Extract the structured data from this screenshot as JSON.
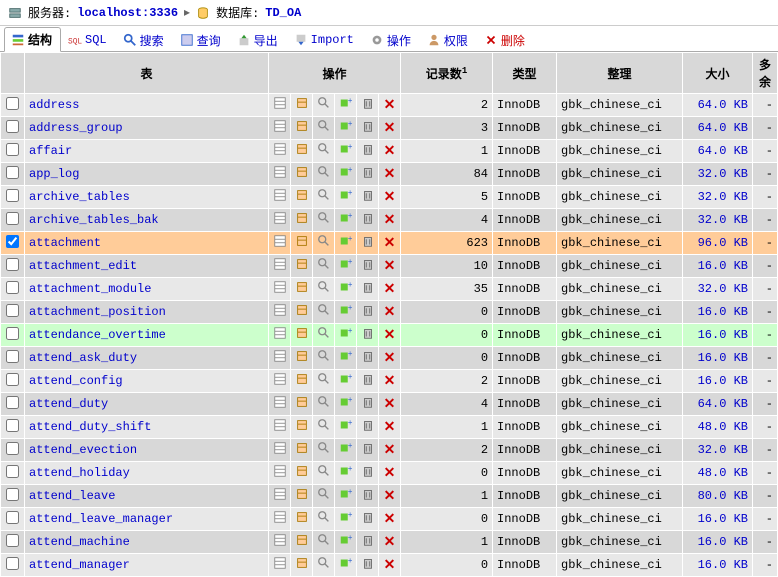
{
  "breadcrumb": {
    "server_label": "服务器: ",
    "server_value": "localhost:3336",
    "db_label": "数据库: ",
    "db_value": "TD_OA"
  },
  "tabs": [
    {
      "label": "结构",
      "icon": "structure-icon"
    },
    {
      "label": "SQL",
      "icon": "sql-icon"
    },
    {
      "label": "搜索",
      "icon": "search-icon"
    },
    {
      "label": "查询",
      "icon": "query-icon"
    },
    {
      "label": "导出",
      "icon": "export-icon"
    },
    {
      "label": "Import",
      "icon": "import-icon"
    },
    {
      "label": "操作",
      "icon": "operations-icon"
    },
    {
      "label": "权限",
      "icon": "privileges-icon"
    },
    {
      "label": "删除",
      "icon": "drop-icon"
    }
  ],
  "headers": {
    "table": "表",
    "action": "操作",
    "records": "记录数",
    "records_sup": "1",
    "type": "类型",
    "collation": "整理",
    "size": "大小",
    "overhead": "多余"
  },
  "rows": [
    {
      "name": "address",
      "rows": 2,
      "type": "InnoDB",
      "coll": "gbk_chinese_ci",
      "size": "64.0 KB",
      "ov": "-",
      "cls": "odd"
    },
    {
      "name": "address_group",
      "rows": 3,
      "type": "InnoDB",
      "coll": "gbk_chinese_ci",
      "size": "64.0 KB",
      "ov": "-",
      "cls": "even"
    },
    {
      "name": "affair",
      "rows": 1,
      "type": "InnoDB",
      "coll": "gbk_chinese_ci",
      "size": "64.0 KB",
      "ov": "-",
      "cls": "odd"
    },
    {
      "name": "app_log",
      "rows": 84,
      "type": "InnoDB",
      "coll": "gbk_chinese_ci",
      "size": "32.0 KB",
      "ov": "-",
      "cls": "even"
    },
    {
      "name": "archive_tables",
      "rows": 5,
      "type": "InnoDB",
      "coll": "gbk_chinese_ci",
      "size": "32.0 KB",
      "ov": "-",
      "cls": "odd"
    },
    {
      "name": "archive_tables_bak",
      "rows": 4,
      "type": "InnoDB",
      "coll": "gbk_chinese_ci",
      "size": "32.0 KB",
      "ov": "-",
      "cls": "even"
    },
    {
      "name": "attachment",
      "rows": 623,
      "type": "InnoDB",
      "coll": "gbk_chinese_ci",
      "size": "96.0 KB",
      "ov": "-",
      "cls": "marked",
      "checked": true
    },
    {
      "name": "attachment_edit",
      "rows": 10,
      "type": "InnoDB",
      "coll": "gbk_chinese_ci",
      "size": "16.0 KB",
      "ov": "-",
      "cls": "even"
    },
    {
      "name": "attachment_module",
      "rows": 35,
      "type": "InnoDB",
      "coll": "gbk_chinese_ci",
      "size": "32.0 KB",
      "ov": "-",
      "cls": "odd"
    },
    {
      "name": "attachment_position",
      "rows": 0,
      "type": "InnoDB",
      "coll": "gbk_chinese_ci",
      "size": "16.0 KB",
      "ov": "-",
      "cls": "even"
    },
    {
      "name": "attendance_overtime",
      "rows": 0,
      "type": "InnoDB",
      "coll": "gbk_chinese_ci",
      "size": "16.0 KB",
      "ov": "-",
      "cls": "marked-green"
    },
    {
      "name": "attend_ask_duty",
      "rows": 0,
      "type": "InnoDB",
      "coll": "gbk_chinese_ci",
      "size": "16.0 KB",
      "ov": "-",
      "cls": "even"
    },
    {
      "name": "attend_config",
      "rows": 2,
      "type": "InnoDB",
      "coll": "gbk_chinese_ci",
      "size": "16.0 KB",
      "ov": "-",
      "cls": "odd"
    },
    {
      "name": "attend_duty",
      "rows": 4,
      "type": "InnoDB",
      "coll": "gbk_chinese_ci",
      "size": "64.0 KB",
      "ov": "-",
      "cls": "even"
    },
    {
      "name": "attend_duty_shift",
      "rows": 1,
      "type": "InnoDB",
      "coll": "gbk_chinese_ci",
      "size": "48.0 KB",
      "ov": "-",
      "cls": "odd"
    },
    {
      "name": "attend_evection",
      "rows": 2,
      "type": "InnoDB",
      "coll": "gbk_chinese_ci",
      "size": "32.0 KB",
      "ov": "-",
      "cls": "even"
    },
    {
      "name": "attend_holiday",
      "rows": 0,
      "type": "InnoDB",
      "coll": "gbk_chinese_ci",
      "size": "48.0 KB",
      "ov": "-",
      "cls": "odd"
    },
    {
      "name": "attend_leave",
      "rows": 1,
      "type": "InnoDB",
      "coll": "gbk_chinese_ci",
      "size": "80.0 KB",
      "ov": "-",
      "cls": "even"
    },
    {
      "name": "attend_leave_manager",
      "rows": 0,
      "type": "InnoDB",
      "coll": "gbk_chinese_ci",
      "size": "16.0 KB",
      "ov": "-",
      "cls": "odd"
    },
    {
      "name": "attend_machine",
      "rows": 1,
      "type": "InnoDB",
      "coll": "gbk_chinese_ci",
      "size": "16.0 KB",
      "ov": "-",
      "cls": "even"
    },
    {
      "name": "attend_manager",
      "rows": 0,
      "type": "InnoDB",
      "coll": "gbk_chinese_ci",
      "size": "16.0 KB",
      "ov": "-",
      "cls": "odd"
    }
  ]
}
